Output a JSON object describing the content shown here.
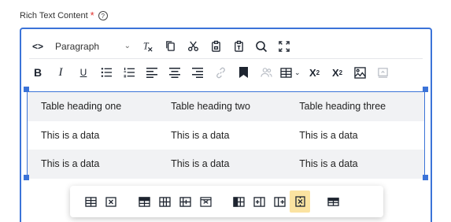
{
  "field": {
    "label": "Rich Text Content",
    "required_mark": "*",
    "help_glyph": "?"
  },
  "toolbar": {
    "source_label": "<>",
    "block_style": "Paragraph",
    "bold": "B",
    "italic": "I",
    "underline": "U",
    "subscript_base": "X",
    "subscript_mark": "2",
    "superscript_base": "X",
    "superscript_mark": "2"
  },
  "table": {
    "headers": [
      "Table heading one",
      "Table heading two",
      "Table heading three"
    ],
    "rows": [
      [
        "This is a data",
        "This is a data",
        "This is a data"
      ],
      [
        "This is a data",
        "This is a data",
        "This is a data"
      ]
    ]
  },
  "colors": {
    "accent": "#3b73d8",
    "active_tool": "#fbe3a1",
    "required": "#e0312d"
  },
  "table_tools": {
    "icons": [
      "table-properties-icon",
      "delete-table-icon",
      "insert-row-above-icon",
      "insert-row-below-icon",
      "delete-row-icon",
      "merge-row-icon",
      "insert-column-left-icon",
      "insert-column-right-icon",
      "delete-column-icon",
      "merge-cells-icon",
      "split-table-icon"
    ],
    "active": "merge-cells-icon"
  }
}
